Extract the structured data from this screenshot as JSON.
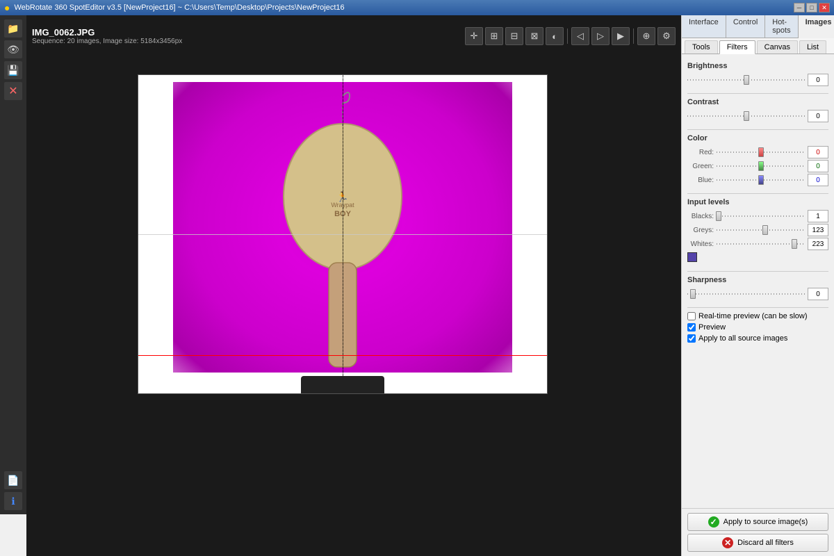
{
  "titlebar": {
    "title": "WebRotate 360 SpotEditor v3.5 [NewProject16] ~ C:\\Users\\Temp\\Desktop\\Projects\\NewProject16",
    "min_label": "─",
    "max_label": "□",
    "close_label": "✕"
  },
  "file": {
    "name": "IMG_0062.JPG",
    "sequence": "Sequence: 20 images, Image size: 5184x3456px"
  },
  "tabs": {
    "top": [
      "Interface",
      "Control",
      "Hot-spots",
      "Images"
    ],
    "active_top": "Images",
    "sub": [
      "Tools",
      "Filters",
      "Canvas",
      "List"
    ],
    "active_sub": "Filters"
  },
  "filters": {
    "brightness": {
      "label": "Brightness",
      "value": 0,
      "thumb_pct": 50
    },
    "contrast": {
      "label": "Contrast",
      "value": 0,
      "thumb_pct": 50
    },
    "color": {
      "label": "Color",
      "red": {
        "label": "Red:",
        "value": 0,
        "thumb_pct": 50
      },
      "green": {
        "label": "Green:",
        "value": 0,
        "thumb_pct": 50
      },
      "blue": {
        "label": "Blue:",
        "value": 0,
        "thumb_pct": 50
      }
    },
    "input_levels": {
      "label": "Input levels",
      "blacks": {
        "label": "Blacks:",
        "value": 1,
        "thumb_pct": 2
      },
      "greys": {
        "label": "Greys:",
        "value": 123,
        "thumb_pct": 55
      },
      "whites": {
        "label": "Whites:",
        "value": 223,
        "thumb_pct": 88
      }
    },
    "sharpness": {
      "label": "Sharpness",
      "value": 0,
      "thumb_pct": 5
    }
  },
  "checkboxes": {
    "realtime": {
      "label": "Real-time preview (can be slow)",
      "checked": false
    },
    "preview": {
      "label": "Preview",
      "checked": true
    },
    "apply_all": {
      "label": "Apply to all source images",
      "checked": true
    }
  },
  "buttons": {
    "apply": "Apply to source image(s)",
    "discard": "Discard all filters"
  },
  "toolbar_buttons": [
    "✛",
    "⊞",
    "⊟",
    "⊠",
    "◐",
    "◁",
    "▷",
    "▶",
    "⊕",
    "⚙"
  ]
}
